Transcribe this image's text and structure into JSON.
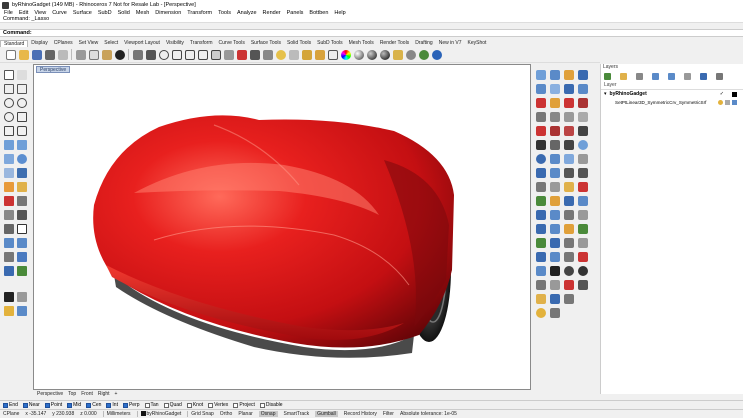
{
  "title_bar": {
    "text": "byRhinoGadget (149 MB) - Rhinoceros 7 Not for Resale Lab - [Perspective]"
  },
  "menu": [
    "File",
    "Edit",
    "View",
    "Curve",
    "Surface",
    "SubD",
    "Solid",
    "Mesh",
    "Dimension",
    "Transform",
    "Tools",
    "Analyze",
    "Render",
    "Panels",
    "Bottben",
    "Help"
  ],
  "command": {
    "history": "Command: _Lasso",
    "prompt_label": "Command:"
  },
  "toolbar_tabs": [
    "Standard",
    "Display",
    "CPlanes",
    "Set View",
    "Select",
    "Viewport Layout",
    "Visibility",
    "Transform",
    "Curve Tools",
    "Surface Tools",
    "Solid Tools",
    "SubD Tools",
    "Mesh Tools",
    "Render Tools",
    "Drafting",
    "New in V7",
    "KeyShot"
  ],
  "toolbar_active_tab": "Standard",
  "viewport": {
    "label": "Perspective",
    "tabs": [
      "Perspective",
      "Top",
      "Front",
      "Right"
    ]
  },
  "layers_panel": {
    "tab": "Layers",
    "column_header": "Layer",
    "layers": [
      {
        "name": "byRhinoGadget",
        "current": true
      },
      {
        "name": "SetPtLinear3D_SymmetricCrv_SymmetricSrf",
        "current": false
      }
    ]
  },
  "osnap": [
    {
      "label": "End",
      "on": true
    },
    {
      "label": "Near",
      "on": true
    },
    {
      "label": "Point",
      "on": true
    },
    {
      "label": "Mid",
      "on": true
    },
    {
      "label": "Cen",
      "on": true
    },
    {
      "label": "Int",
      "on": true
    },
    {
      "label": "Perp",
      "on": true
    },
    {
      "label": "Tan",
      "on": false
    },
    {
      "label": "Quad",
      "on": false
    },
    {
      "label": "Knot",
      "on": false
    },
    {
      "label": "Vertex",
      "on": false
    },
    {
      "label": "Project",
      "on": false
    },
    {
      "label": "Disable",
      "on": false
    }
  ],
  "status_bar": {
    "cplane": "CPlane",
    "x": "x -35.147",
    "y": "y 230.938",
    "z": "z 0.000",
    "units": "Millimeters",
    "layer": "byRhinoGadget",
    "items": [
      "Grid Snap",
      "Ortho",
      "Planar",
      "Osnap",
      "SmartTrack",
      "Gumball",
      "Record History",
      "Filter"
    ],
    "tolerance": "Absolute tolerance: 1e-05"
  },
  "colors": {
    "car_red": "#d5141a",
    "car_dark": "#5a0a0a",
    "toolbar_bg": "#f0f0f0",
    "viewport_label": "#c7d4e8"
  }
}
